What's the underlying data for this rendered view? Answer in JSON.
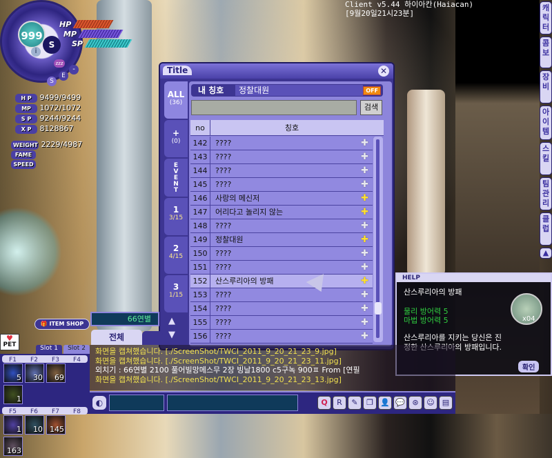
{
  "client_info": {
    "version": "Client v5.44 하이아칸(Haiacan)",
    "datetime": "[9월20일21시23분]"
  },
  "status": {
    "level": "999",
    "hp_label": "HP",
    "mp_label": "MP",
    "sp_label": "SP",
    "stats": [
      {
        "label": "H P",
        "value": "9499/9499"
      },
      {
        "label": "MP",
        "value": "1072/1072"
      },
      {
        "label": "S P",
        "value": "9244/9244"
      },
      {
        "label": "X P",
        "value": "8128867"
      },
      {
        "label": "WEIGHT",
        "value": "2229/4987"
      },
      {
        "label": "FAME",
        "value": ""
      },
      {
        "label": "SPEED",
        "value": ""
      }
    ],
    "buttons": [
      "i",
      "zzz",
      "-",
      "E",
      "S"
    ]
  },
  "title_window": {
    "title": "Title",
    "close": "✕",
    "tabs": [
      {
        "label": "ALL",
        "sub": "(36)"
      },
      {
        "label": "+",
        "sub": "(0)"
      },
      {
        "label": "EVENT",
        "sub": ""
      },
      {
        "label": "1",
        "sub": "3/15"
      },
      {
        "label": "2",
        "sub": "4/15"
      },
      {
        "label": "3",
        "sub": "1/15"
      }
    ],
    "my_title_label": "내 칭호",
    "my_title_value": "정찰대원",
    "off_badge": "OFF",
    "search_value": "",
    "search_button": "검색",
    "columns": [
      "no",
      "칭호"
    ],
    "rows": [
      {
        "no": "142",
        "name": "????",
        "active": false
      },
      {
        "no": "143",
        "name": "????",
        "active": false
      },
      {
        "no": "144",
        "name": "????",
        "active": false
      },
      {
        "no": "145",
        "name": "????",
        "active": false
      },
      {
        "no": "146",
        "name": "사랑의 메신저",
        "active": true
      },
      {
        "no": "147",
        "name": "어리다고 놀리지 않는",
        "active": true
      },
      {
        "no": "148",
        "name": "????",
        "active": false
      },
      {
        "no": "149",
        "name": "정찰대원",
        "active": true
      },
      {
        "no": "150",
        "name": "????",
        "active": false
      },
      {
        "no": "151",
        "name": "????",
        "active": false
      },
      {
        "no": "152",
        "name": "산스루리아의 방패",
        "active": true
      },
      {
        "no": "153",
        "name": "????",
        "active": false
      },
      {
        "no": "154",
        "name": "????",
        "active": false
      },
      {
        "no": "155",
        "name": "????",
        "active": false
      },
      {
        "no": "156",
        "name": "????",
        "active": false
      }
    ]
  },
  "help": {
    "header": "HELP",
    "title": "산스루리아의 방패",
    "effects": [
      "물리 방어력 5",
      "마법 방어력 5"
    ],
    "description": "산스루리아를 지키는 당신은 진정한 산스루리아의 방패입니다.",
    "count": "x04",
    "confirm": "확인"
  },
  "chat": {
    "name_box": "66연별",
    "tab_all": "전체",
    "lines": [
      {
        "text": "화면을 캡쳐했습니다. [./ScreenShot/TWCI_2011_9_20_21_23_9.jpg]",
        "color": "#f0e050"
      },
      {
        "text": "화면을 캡쳐했습니다. [./ScreenShot/TWCI_2011_9_20_21_23_11.jpg]",
        "color": "#f0e050"
      },
      {
        "text": "외치기 : 66연별 2100 풀어빌망메스무 2장 빙날1800 c5구녹 900ㅍ From [연필",
        "color": "#ffffff"
      },
      {
        "text": "화면을 캡쳐했습니다. [./ScreenShot/TWCI_2011_9_20_21_23_13.jpg]",
        "color": "#f0e050"
      }
    ]
  },
  "hotkeys": {
    "slot_tabs": [
      "Slot 1",
      "Slot 2"
    ],
    "keys": [
      {
        "k": "F1",
        "n": "5"
      },
      {
        "k": "F2",
        "n": "30"
      },
      {
        "k": "F3",
        "n": "69"
      },
      {
        "k": "F4",
        "n": "1"
      },
      {
        "k": "F5",
        "n": "1"
      },
      {
        "k": "F6",
        "n": "10"
      },
      {
        "k": "F7",
        "n": "145"
      },
      {
        "k": "F8",
        "n": "163"
      }
    ]
  },
  "item_shop": "ITEM SHOP",
  "pet": "PET",
  "side_menu": [
    "캐릭터",
    "콤보",
    "장비",
    "아이템",
    "스킬",
    "팀관리",
    "클럽"
  ],
  "bottom_icons": [
    "Q",
    "R",
    "✎",
    "❐",
    "👤",
    "💬",
    "⊛",
    "☺",
    "▤"
  ]
}
